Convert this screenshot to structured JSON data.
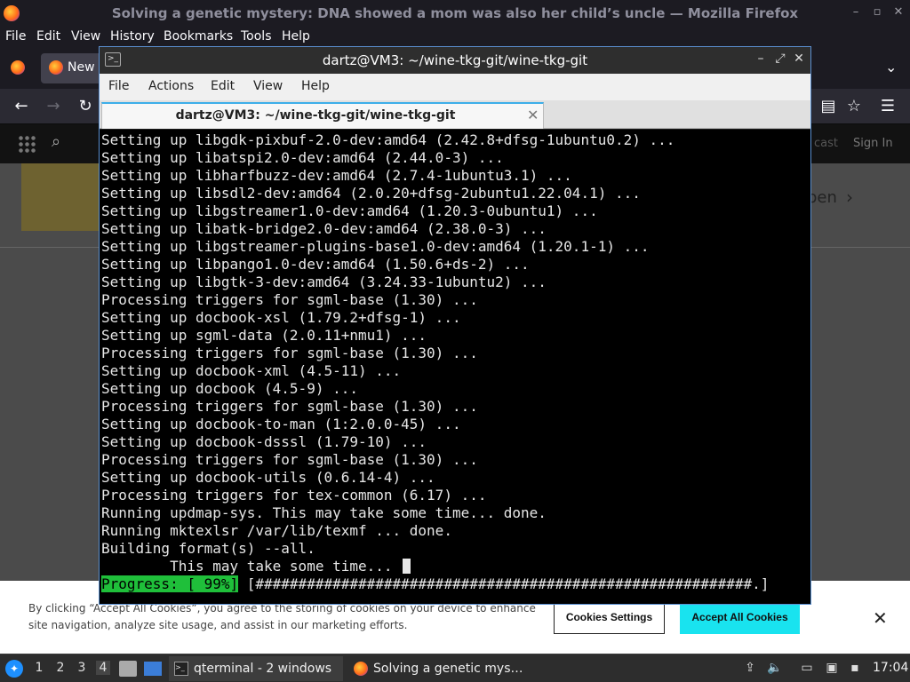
{
  "firefox": {
    "title": "Solving a genetic mystery: DNA showed a mom was also her child’s uncle — Mozilla Firefox",
    "menu": [
      "File",
      "Edit",
      "View",
      "History",
      "Bookmarks",
      "Tools",
      "Help"
    ],
    "tab_label": "New",
    "window_controls": {
      "minimize": "–",
      "maximize": "▫",
      "close": "✕"
    },
    "nav": {
      "back": "←",
      "forward": "→",
      "reload": "↻",
      "reader": "▤",
      "bookmark": "☆",
      "menu": "☰",
      "tabs_chevron": "⌄"
    }
  },
  "site": {
    "podcast_fragment": "cast",
    "signin": "Sign In",
    "open_fragment": "pen",
    "open_arrow": "›"
  },
  "cookie": {
    "text": "By clicking “Accept All Cookies”, you agree to the storing of cookies on your device to enhance site navigation, analyze site usage, and assist in our marketing efforts.",
    "settings_label": "Cookies Settings",
    "accept_label": "Accept All Cookies",
    "close": "✕"
  },
  "terminal": {
    "title": "dartz@VM3: ~/wine-tkg-git/wine-tkg-git",
    "menu": [
      "File",
      "Actions",
      "Edit",
      "View",
      "Help"
    ],
    "tab_label": "dartz@VM3: ~/wine-tkg-git/wine-tkg-git",
    "tab_close": "✕",
    "window_controls": {
      "minimize": "–",
      "maximize": "⤢",
      "close": "✕"
    },
    "lines": [
      "Setting up libgdk-pixbuf-2.0-dev:amd64 (2.42.8+dfsg-1ubuntu0.2) ...",
      "Setting up libatspi2.0-dev:amd64 (2.44.0-3) ...",
      "Setting up libharfbuzz-dev:amd64 (2.7.4-1ubuntu3.1) ...",
      "Setting up libsdl2-dev:amd64 (2.0.20+dfsg-2ubuntu1.22.04.1) ...",
      "Setting up libgstreamer1.0-dev:amd64 (1.20.3-0ubuntu1) ...",
      "Setting up libatk-bridge2.0-dev:amd64 (2.38.0-3) ...",
      "Setting up libgstreamer-plugins-base1.0-dev:amd64 (1.20.1-1) ...",
      "Setting up libpango1.0-dev:amd64 (1.50.6+ds-2) ...",
      "Setting up libgtk-3-dev:amd64 (3.24.33-1ubuntu2) ...",
      "Processing triggers for sgml-base (1.30) ...",
      "Setting up docbook-xsl (1.79.2+dfsg-1) ...",
      "Setting up sgml-data (2.0.11+nmu1) ...",
      "Processing triggers for sgml-base (1.30) ...",
      "Setting up docbook-xml (4.5-11) ...",
      "Setting up docbook (4.5-9) ...",
      "Processing triggers for sgml-base (1.30) ...",
      "Setting up docbook-to-man (1:2.0.0-45) ...",
      "Setting up docbook-dsssl (1.79-10) ...",
      "Processing triggers for sgml-base (1.30) ...",
      "Setting up docbook-utils (0.6.14-4) ...",
      "Processing triggers for tex-common (6.17) ...",
      "Running updmap-sys. This may take some time... done.",
      "Running mktexlsr /var/lib/texmf ... done.",
      "Building format(s) --all.",
      "        This may take some time... "
    ],
    "progress_label": "Progress: [ 99%]",
    "progress_bar": " [##########################################################.]"
  },
  "taskbar": {
    "start": "✦",
    "workspaces": [
      "1",
      "2",
      "3",
      "4"
    ],
    "active_workspace": "4",
    "task_terminal": "qterminal - 2 windows",
    "task_terminal_icon": ">_",
    "task_firefox": "Solving a genetic mys…",
    "tray": {
      "upload": "⇪",
      "volume": "🔈",
      "clipboard": "▭",
      "network": "▣",
      "notify": "▪"
    },
    "clock": "17:04"
  }
}
